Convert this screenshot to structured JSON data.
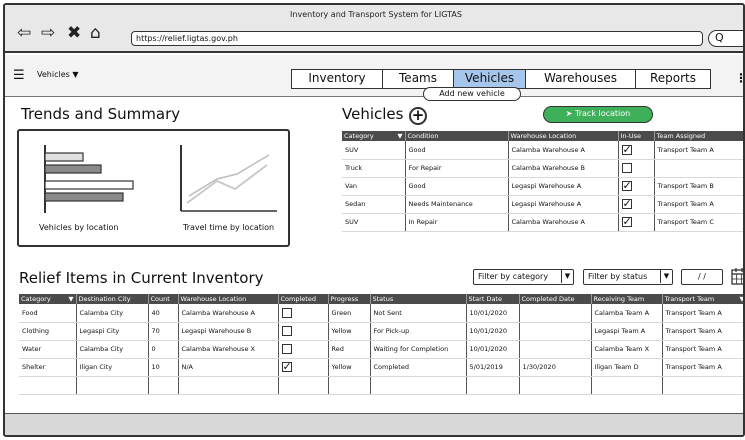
{
  "browser": {
    "window_title": "Inventory and Transport System for LIGTAS",
    "url": "https://relief.ligtas.gov.ph",
    "search_glyph": "Q"
  },
  "menubar": {
    "menu_label": "Vehicles",
    "tabs": [
      {
        "label": "Inventory",
        "active": false
      },
      {
        "label": "Teams",
        "active": false
      },
      {
        "label": "Vehicles",
        "active": true
      },
      {
        "label": "Warehouses",
        "active": false
      },
      {
        "label": "Reports",
        "active": false
      }
    ]
  },
  "trends": {
    "title": "Trends and Summary",
    "chart1_label": "Vehicles by location",
    "chart2_label": "Travel time by location"
  },
  "vehicles": {
    "title": "Vehicles",
    "add_tooltip": "Add new vehicle",
    "track_label": "Track location",
    "columns": [
      "Category",
      "Condition",
      "Warehouse Location",
      "In-Use",
      "Team Assigned"
    ],
    "rows": [
      {
        "category": "SUV",
        "condition": "Good",
        "location": "Calamba Warehouse A",
        "in_use": true,
        "team": "Transport Team A"
      },
      {
        "category": "Truck",
        "condition": "For Repair",
        "location": "Calamba Warehouse B",
        "in_use": false,
        "team": ""
      },
      {
        "category": "Van",
        "condition": "Good",
        "location": "Legaspi Warehouse A",
        "in_use": true,
        "team": "Transport Team B"
      },
      {
        "category": "Sedan",
        "condition": "Needs Maintenance",
        "location": "Legaspi Warehouse A",
        "in_use": true,
        "team": "Transport Team A"
      },
      {
        "category": "SUV",
        "condition": "In Repair",
        "location": "Calamba Warehouse A",
        "in_use": true,
        "team": "Transport Team C"
      }
    ]
  },
  "relief": {
    "title": "Relief Items in Current Inventory",
    "filter_category": "Filter by category",
    "filter_status": "Filter by status",
    "date_value": "/ /",
    "columns": [
      "Category",
      "Destination City",
      "Count",
      "Warehouse Location",
      "Completed",
      "Progress",
      "Status",
      "Start Date",
      "Completed Date",
      "Receiving Team",
      "Transport Team"
    ],
    "rows": [
      {
        "category": "Food",
        "city": "Calamba City",
        "count": "40",
        "location": "Calamba Warehouse A",
        "completed": false,
        "progress": "Green",
        "status": "Not Sent",
        "start": "10/01/2020",
        "end": "",
        "receiving": "Calamba Team A",
        "transport": "Transport Team A"
      },
      {
        "category": "Clothing",
        "city": "Legaspi City",
        "count": "70",
        "location": "Legaspi Warehouse B",
        "completed": false,
        "progress": "Yellow",
        "status": "For Pick-up",
        "start": "10/01/2020",
        "end": "",
        "receiving": "Legaspi Team A",
        "transport": "Transport Team A"
      },
      {
        "category": "Water",
        "city": "Calamba City",
        "count": "0",
        "location": "Calamba Warehouse X",
        "completed": false,
        "progress": "Red",
        "status": "Waiting for Completion",
        "start": "10/01/2020",
        "end": "",
        "receiving": "Calamba Team X",
        "transport": "Transport Team A"
      },
      {
        "category": "Shelter",
        "city": "Iligan City",
        "count": "10",
        "location": "N/A",
        "completed": true,
        "progress": "Yellow",
        "status": "Completed",
        "start": "5/01/2019",
        "end": "1/30/2020",
        "receiving": "Iligan Team D",
        "transport": "Transport Team A"
      }
    ]
  },
  "colors": {
    "active_tab": "#a6c6ec",
    "track_button": "#3fb05a",
    "table_header": "#4b4b4b"
  }
}
